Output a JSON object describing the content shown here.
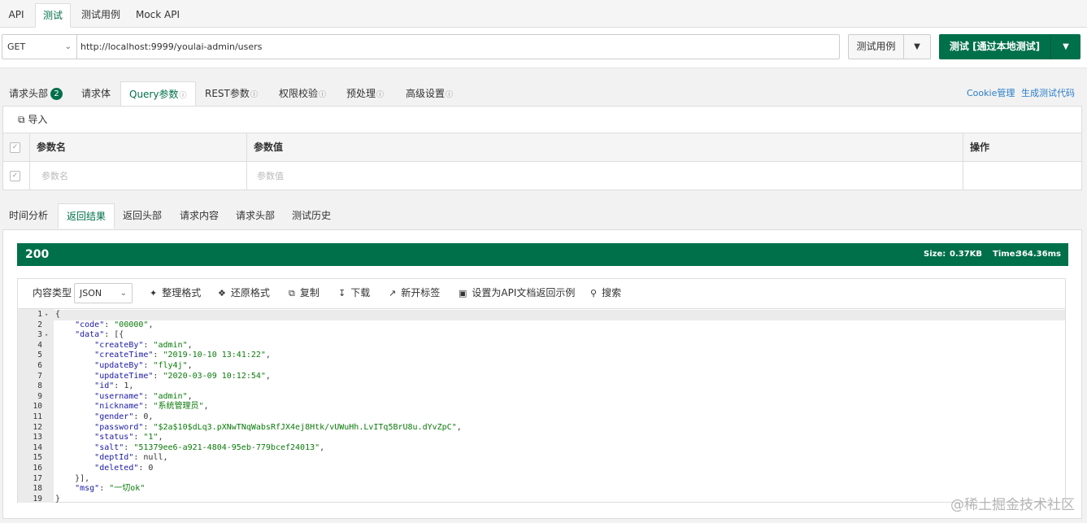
{
  "top_tabs": [
    {
      "label": "API"
    },
    {
      "label": "测试"
    },
    {
      "label": "测试用例"
    },
    {
      "label": "Mock API"
    }
  ],
  "request": {
    "method": "GET",
    "url": "http://localhost:9999/youlai-admin/users",
    "case_button": "测试用例",
    "test_button": "测试 [通过本地测试]"
  },
  "request_tabs": [
    {
      "label": "请求头部",
      "badge": "2"
    },
    {
      "label": "请求体"
    },
    {
      "label": "Query参数"
    },
    {
      "label": "REST参数"
    },
    {
      "label": "权限校验"
    },
    {
      "label": "预处理"
    },
    {
      "label": "高级设置"
    }
  ],
  "right_links": {
    "cookie": "Cookie管理",
    "gen_code": "生成测试代码"
  },
  "query_panel": {
    "import_label": "导入",
    "columns": [
      "参数名",
      "参数值",
      "操作"
    ],
    "row_placeholders": {
      "name": "参数名",
      "value": "参数值"
    }
  },
  "result_tabs": [
    {
      "label": "时间分析"
    },
    {
      "label": "返回结果"
    },
    {
      "label": "返回头部"
    },
    {
      "label": "请求内容"
    },
    {
      "label": "请求头部"
    },
    {
      "label": "测试历史"
    }
  ],
  "status": {
    "code": "200",
    "size_label": "Size:",
    "size": "0.37KB",
    "time_label": "Time:",
    "time": "364.36ms"
  },
  "viewer_toolbar": {
    "content_type_label": "内容类型",
    "format": "JSON",
    "beautify": "整理格式",
    "restore": "还原格式",
    "copy": "复制",
    "download": "下载",
    "new_tab": "新开标签",
    "set_example": "设置为API文档返回示例",
    "search": "搜索"
  },
  "code_lines": [
    "{",
    "    \"code\": \"00000\",",
    "    \"data\": [{",
    "        \"createBy\": \"admin\",",
    "        \"createTime\": \"2019-10-10 13:41:22\",",
    "        \"updateBy\": \"fly4j\",",
    "        \"updateTime\": \"2020-03-09 10:12:54\",",
    "        \"id\": 1,",
    "        \"username\": \"admin\",",
    "        \"nickname\": \"系统管理员\",",
    "        \"gender\": 0,",
    "        \"password\": \"$2a$10$dLq3.pXNwTNqWabsRfJX4ej8Htk/vUWuHh.LvITq5BrU8u.dYvZpC\",",
    "        \"status\": \"1\",",
    "        \"salt\": \"51379ee6-a921-4804-95eb-779bcef24013\",",
    "        \"deptId\": null,",
    "        \"deleted\": 0",
    "    }],",
    "    \"msg\": \"一切ok\"",
    "}"
  ],
  "watermark": "@稀土掘金技术社区",
  "colors": {
    "accent": "#00704a",
    "link": "#2a7ec7"
  },
  "icons": [
    "chevron-down-icon",
    "info-icon",
    "import-icon",
    "checkbox-icon",
    "beautify-icon",
    "restore-icon",
    "copy-icon",
    "download-icon",
    "new-tab-icon",
    "save-icon",
    "search-icon",
    "fold-arrow-icon"
  ]
}
